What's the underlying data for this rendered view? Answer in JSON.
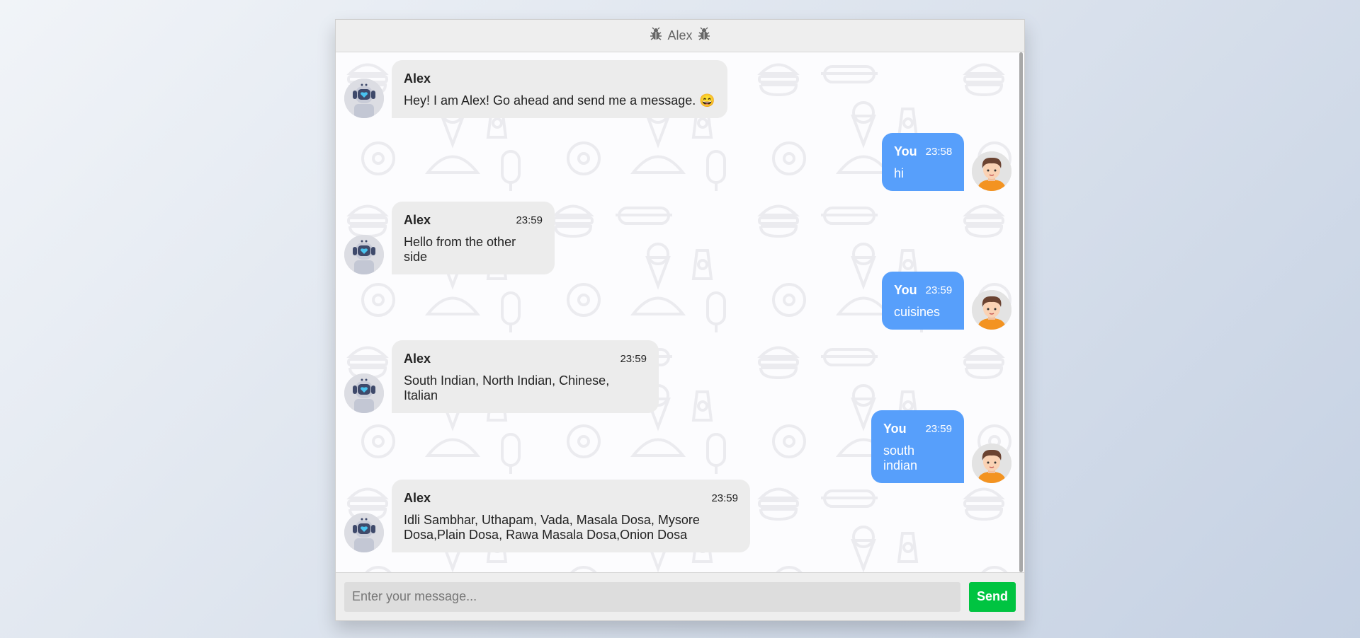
{
  "header": {
    "title": "Alex",
    "icon": "bug-icon"
  },
  "messages": [
    {
      "side": "left",
      "sender": "Alex",
      "time": "",
      "text": "Hey! I am Alex! Go ahead and send me a message. 😄",
      "avatar": "robot-avatar"
    },
    {
      "side": "right",
      "sender": "You",
      "time": "23:58",
      "text": "hi",
      "avatar": "user-avatar"
    },
    {
      "side": "left",
      "sender": "Alex",
      "time": "23:59",
      "text": "Hello from the other side",
      "avatar": "robot-avatar"
    },
    {
      "side": "right",
      "sender": "You",
      "time": "23:59",
      "text": "cuisines",
      "avatar": "user-avatar"
    },
    {
      "side": "left",
      "sender": "Alex",
      "time": "23:59",
      "text": "South Indian, North Indian, Chinese, Italian",
      "avatar": "robot-avatar"
    },
    {
      "side": "right",
      "sender": "You",
      "time": "23:59",
      "text": "south indian",
      "avatar": "user-avatar"
    },
    {
      "side": "left",
      "sender": "Alex",
      "time": "23:59",
      "text": "Idli Sambhar, Uthapam, Vada, Masala Dosa, Mysore Dosa,Plain Dosa, Rawa Masala Dosa,Onion Dosa",
      "avatar": "robot-avatar"
    }
  ],
  "input": {
    "placeholder": "Enter your message...",
    "value": ""
  },
  "send_button": {
    "label": "Send"
  },
  "colors": {
    "user_bubble": "#579ffb",
    "bot_bubble": "#ececec",
    "send_button": "#00c441",
    "header_bg": "#eeeeee"
  }
}
